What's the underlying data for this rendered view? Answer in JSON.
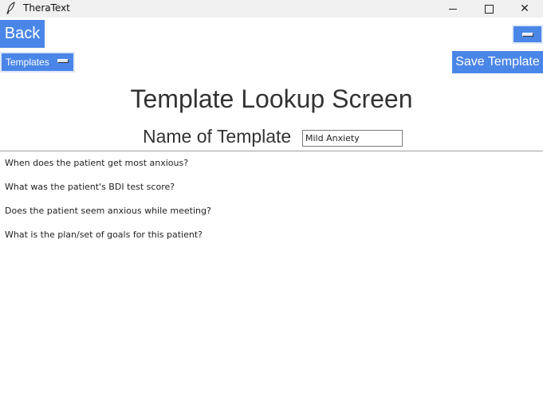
{
  "window": {
    "title": "TheraText",
    "min_symbol": "",
    "close_symbol": "✕"
  },
  "toolbar": {
    "back_label": "Back",
    "templates_menu_label": "Templates",
    "save_label": "Save Template"
  },
  "main": {
    "title": "Template Lookup Screen",
    "name_label": "Name of Template",
    "name_value": "Mild Anxiety"
  },
  "questions": [
    "When does the patient get most anxious?",
    "What was the patient's BDI test score?",
    "Does the patient seem anxious while meeting?",
    "What is the plan/set of goals for this patient?"
  ],
  "colors": {
    "accent": "#4a86e8",
    "background": "#ffffff",
    "titlebar": "#f0f0f0"
  },
  "icons": {
    "app": "feather-icon",
    "minimize": "minimize-icon",
    "maximize": "maximize-icon",
    "close": "close-icon"
  }
}
